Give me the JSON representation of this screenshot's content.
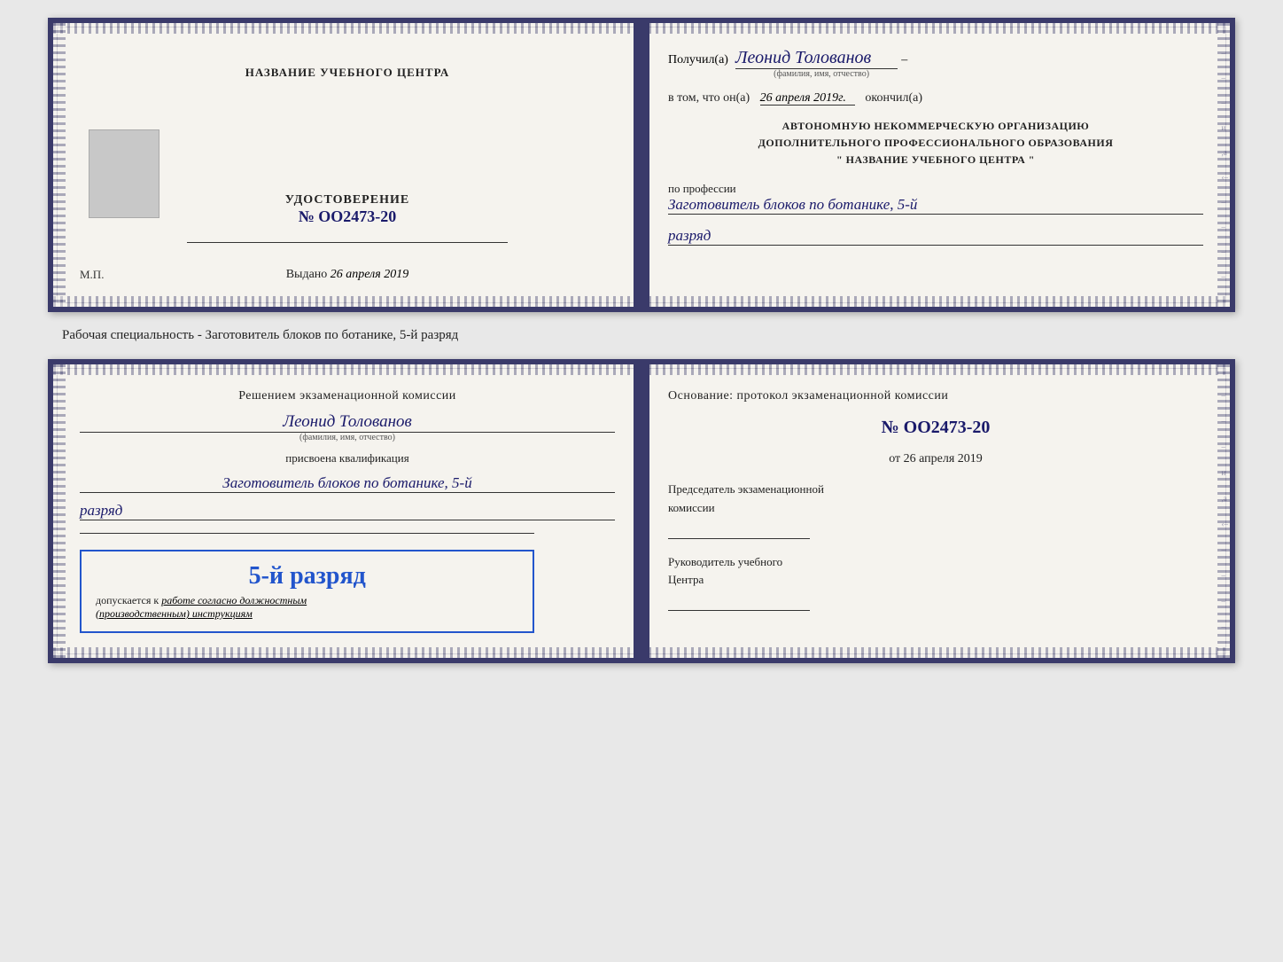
{
  "top_doc": {
    "left": {
      "center_title": "НАЗВАНИЕ УЧЕБНОГО ЦЕНТРА",
      "cert_label": "УДОСТОВЕРЕНИЕ",
      "cert_number": "№ OO2473-20",
      "issued_label": "Выдано",
      "issued_date": "26 апреля 2019",
      "mp": "М.П."
    },
    "right": {
      "recipient_prefix": "Получил(а)",
      "recipient_name": "Леонид Толованов",
      "recipient_hint": "(фамилия, имя, отчество)",
      "date_prefix": "в том, что он(а)",
      "date_value": "26 апреля 2019г.",
      "date_suffix": "окончил(а)",
      "org_line1": "АВТОНОМНУЮ НЕКОММЕРЧЕСКУЮ ОРГАНИЗАЦИЮ",
      "org_line2": "ДОПОЛНИТЕЛЬНОГО ПРОФЕССИОНАЛЬНОГО ОБРАЗОВАНИЯ",
      "org_line3": "\" НАЗВАНИЕ УЧЕБНОГО ЦЕНТРА \"",
      "profession_label": "по профессии",
      "profession_value": "Заготовитель блоков по ботанике, 5-й",
      "razryad_value": "разряд"
    }
  },
  "specialty_text": "Рабочая специальность - Заготовитель блоков по ботанике, 5-й разряд",
  "bottom_doc": {
    "left": {
      "commission_title": "Решением экзаменационной комиссии",
      "commission_name": "Леонид Толованов",
      "commission_hint": "(фамилия, имя, отчество)",
      "qualification_label": "присвоена квалификация",
      "qualification_value": "Заготовитель блоков по ботанике, 5-й",
      "qualification_razryad": "разряд",
      "stamp_rank": "5-й разряд",
      "stamp_admission_prefix": "допускается к",
      "stamp_admission_italic": "работе согласно должностным",
      "stamp_admission_italic2": "(производственным) инструкциям"
    },
    "right": {
      "basis_title": "Основание: протокол экзаменационной комиссии",
      "protocol_number": "№ OO2473-20",
      "protocol_date_prefix": "от",
      "protocol_date": "26 апреля 2019",
      "chairman_label": "Председатель экзаменационной",
      "chairman_label2": "комиссии",
      "director_label": "Руководитель учебного",
      "director_label2": "Центра"
    }
  }
}
